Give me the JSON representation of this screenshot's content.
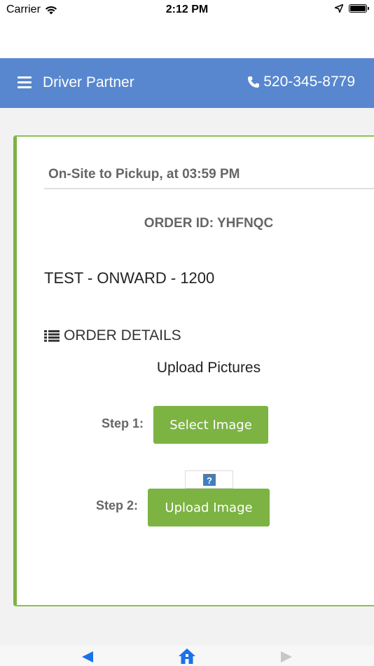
{
  "status_bar": {
    "carrier": "Carrier",
    "time": "2:12 PM"
  },
  "navbar": {
    "title": "Driver Partner",
    "phone": "520-345-8779"
  },
  "card": {
    "status_line": "On-Site to Pickup, at 03:59 PM",
    "order_id": "ORDER ID: YHFNQC",
    "order_name": "TEST - ONWARD - 1200",
    "details_label": "ORDER DETAILS",
    "upload_title": "Upload Pictures",
    "step1_label": "Step 1:",
    "step1_button": "Select Image",
    "preview_placeholder": "?",
    "step2_label": "Step 2:",
    "step2_button": "Upload Image"
  },
  "colors": {
    "navbar": "#5887cf",
    "accent_green": "#7cb342",
    "nav_blue": "#1a73e8"
  },
  "icons": [
    "wifi-icon",
    "location-arrow-icon",
    "battery-icon",
    "menu-icon",
    "phone-icon",
    "list-icon",
    "broken-image-icon",
    "back-arrow-icon",
    "home-icon",
    "forward-arrow-icon"
  ]
}
